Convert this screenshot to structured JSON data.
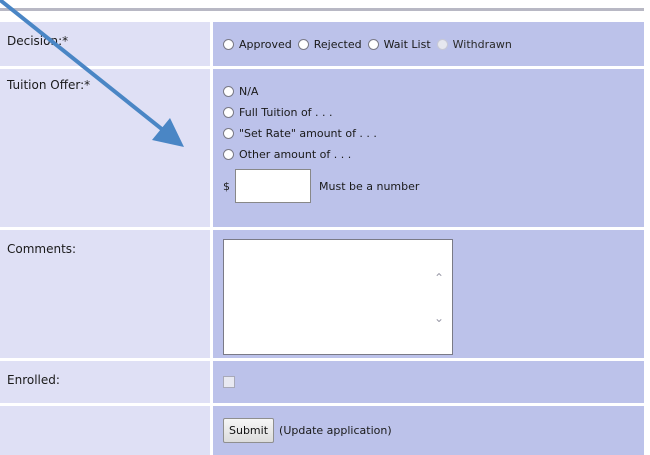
{
  "decision": {
    "label": "Decision:*",
    "options": [
      "Approved",
      "Rejected",
      "Wait List",
      "Withdrawn"
    ]
  },
  "tuition": {
    "label": "Tuition Offer:*",
    "options": [
      "N/A",
      "Full Tuition of . . .",
      "\"Set Rate\" amount of . . .",
      "Other amount of . . ."
    ],
    "currency": "$",
    "amount_value": "",
    "amount_hint": "Must be a number"
  },
  "comments": {
    "label": "Comments:",
    "value": ""
  },
  "enrolled": {
    "label": "Enrolled:",
    "checked": false
  },
  "submit": {
    "button_label": "Submit",
    "note": "(Update application)"
  },
  "colors": {
    "label_cell": "#dfe0f5",
    "field_cell": "#bcc2ea",
    "annotation_arrow": "#4a86c5"
  }
}
